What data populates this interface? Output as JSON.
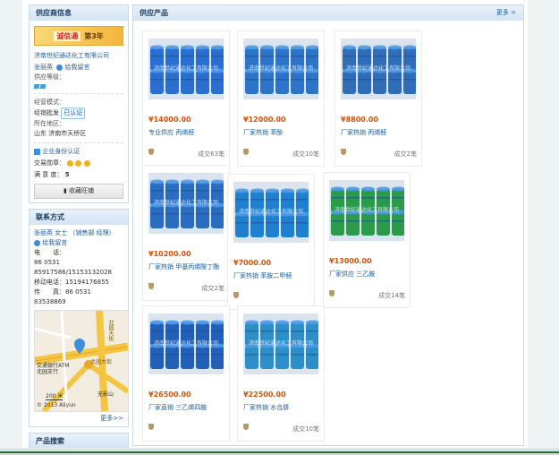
{
  "supplier": {
    "header": "供应商信息",
    "cert_badge": "诚信通",
    "cert_years": "第3年",
    "company_name": "济南世纪通达化工有限公司",
    "contact_name": "张丽英",
    "message_label": "给我留言",
    "supply_level_label": "供应等级：",
    "business_mode_label": "经营模式：",
    "business_mode_value": "经销批发",
    "verified_tag": "已认证",
    "location_label": "所在地区：",
    "location_value": "山东 济南市天桥区",
    "enterprise_verify": "企业身份认证",
    "trade_score_label": "交易勋章：",
    "satisfaction_label": "满 意 度：",
    "satisfaction_value": "5",
    "favorite_button": "收藏旺铺"
  },
  "contact": {
    "header": "联系方式",
    "person": "张丽英 女士 （销售部 经理）",
    "message_label": "给我留言",
    "phone_label": "电　　话：",
    "phone_line1": "86 0531",
    "phone_line2": "85917586/15153132028",
    "mobile_label": "移动电话：",
    "mobile_value": "15194176855",
    "fax_label": "传　　真：",
    "fax_value": "86 0531 83538869",
    "map_labels": {
      "bank": "交通银行ATM",
      "bank2": "北园支行",
      "road1": "北园大街",
      "road2": "北园大街",
      "road3": "无影山",
      "scale": "200 米",
      "copyright": "© 2013 Aliyun"
    },
    "more": "更多>>"
  },
  "product_search": {
    "header": "产品搜索"
  },
  "main": {
    "header": "供应产品",
    "more": "更多 >",
    "watermark": "济南世纪通达化工有限公司",
    "products": [
      {
        "price": "¥14000.00",
        "name": "专业供应 丙烯醛",
        "sold": "成交63笔",
        "color": "#2b6ed1"
      },
      {
        "price": "¥12000.00",
        "name": "厂家热销 苯酚",
        "sold": "成交10笔",
        "color": "#2c74c8"
      },
      {
        "price": "¥8800.00",
        "name": "厂家热销 丙烯醛",
        "sold": "成交2笔",
        "color": "#2f6db8"
      },
      {
        "price": "¥10200.00",
        "name": "厂家热销 甲基丙烯酸丁酯",
        "sold": "成交2笔",
        "color": "#2a6cc0"
      },
      {
        "price": "¥7000.00",
        "name": "厂家热销 苯胺二甲醛",
        "sold": "",
        "color": "#1f7fd0"
      },
      {
        "price": "¥13000.00",
        "name": "厂家供应 三乙胺",
        "sold": "成交14笔",
        "color": "#2b9a4a"
      },
      {
        "price": "¥26500.00",
        "name": "厂家直销 三乙烯四胺",
        "sold": "",
        "color": "#2260b8"
      },
      {
        "price": "¥22500.00",
        "name": "厂家热销 水合肼",
        "sold": "成交10笔",
        "color": "#2d8fc8"
      }
    ]
  }
}
